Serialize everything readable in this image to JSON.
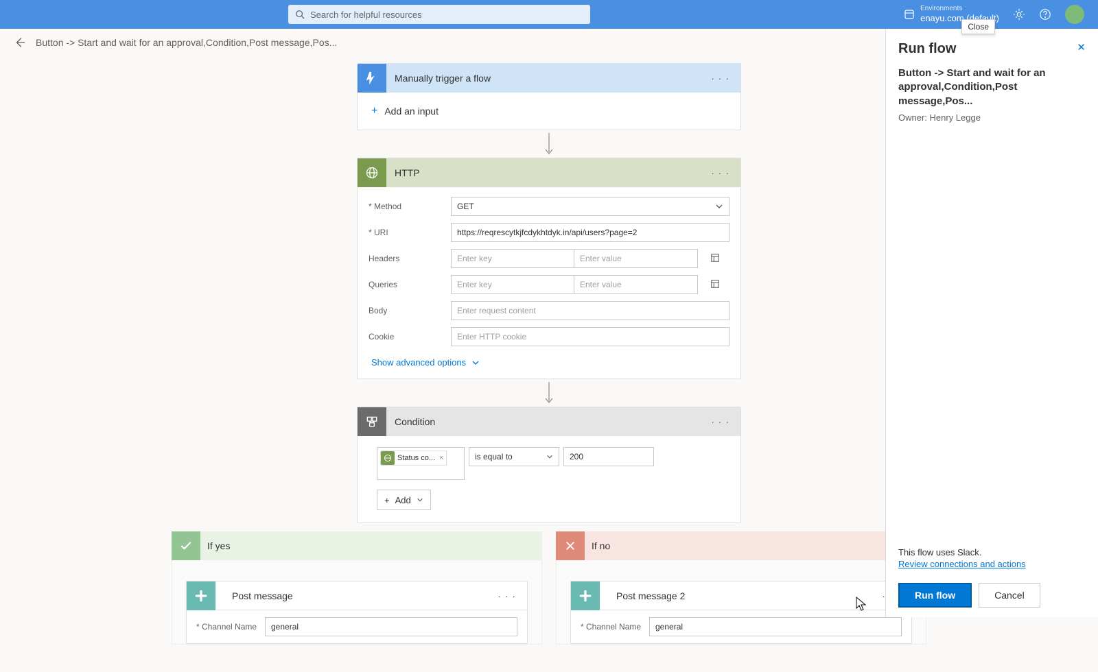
{
  "topbar": {
    "search_placeholder": "Search for helpful resources",
    "env_label": "Environments",
    "env_value": "enayu.com (default)",
    "close_tooltip": "Close"
  },
  "breadcrumb": {
    "flow_name": "Button -> Start and wait for an approval,Condition,Post message,Pos..."
  },
  "trigger": {
    "title": "Manually trigger a flow",
    "add_input": "Add an input"
  },
  "http": {
    "title": "HTTP",
    "method_label": "Method",
    "method_value": "GET",
    "uri_label": "URI",
    "uri_value": "https://reqrescytkjfcdykhtdyk.in/api/users?page=2",
    "headers_label": "Headers",
    "queries_label": "Queries",
    "key_ph": "Enter key",
    "value_ph": "Enter value",
    "body_label": "Body",
    "body_ph": "Enter request content",
    "cookie_label": "Cookie",
    "cookie_ph": "Enter HTTP cookie",
    "show_advanced": "Show advanced options"
  },
  "condition": {
    "title": "Condition",
    "token_label": "Status co...",
    "operator": "is equal to",
    "value": "200",
    "add_label": "Add"
  },
  "branches": {
    "yes_label": "If yes",
    "no_label": "If no",
    "yes_action_title": "Post message",
    "no_action_title": "Post message 2",
    "channel_label": "Channel Name",
    "channel_value": "general"
  },
  "panel": {
    "title": "Run flow",
    "flow_name": "Button -> Start and wait for an approval,Condition,Post message,Pos...",
    "owner_label": "Owner: Henry Legge",
    "note": "This flow uses Slack.",
    "review_link": "Review connections and actions",
    "run_btn": "Run flow",
    "cancel_btn": "Cancel"
  }
}
